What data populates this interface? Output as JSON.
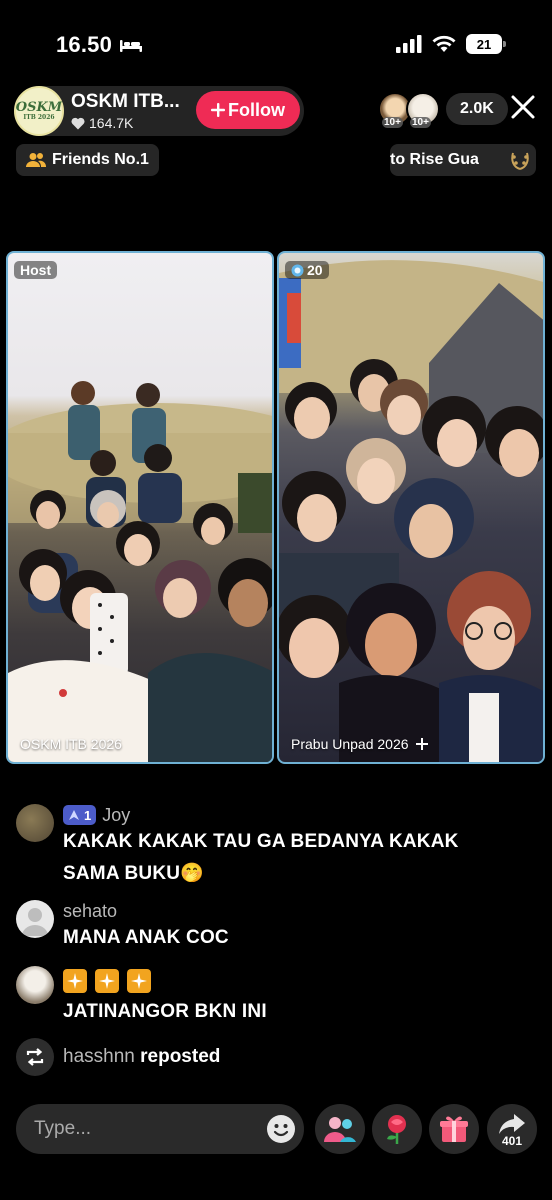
{
  "status_bar": {
    "time": "16.50",
    "battery": "21"
  },
  "host": {
    "avatar_text_big": "OSKM",
    "avatar_text_small": "ITB 2026",
    "name": "OSKM ITB...",
    "likes": "164.7K",
    "follow_label": "Follow"
  },
  "viewers": {
    "badge_1": "10+",
    "badge_2": "10+",
    "count": "2.0K"
  },
  "chips": {
    "friends": "Friends No.1",
    "rank_text": "to Rise   Gua"
  },
  "panels": {
    "left": {
      "tag": "Host",
      "label": "OSKM ITB 2026"
    },
    "right": {
      "tag": "20",
      "label": "Prabu Unpad 2026"
    }
  },
  "comments": [
    {
      "level": "1",
      "user": "Joy",
      "text": "KAKAK KAKAK TAU GA BEDANYA KAKAK SAMA BUKU🤭"
    },
    {
      "user": "sehato",
      "text": "MANA ANAK COC"
    },
    {
      "user": "",
      "text": "JATINANGOR BKN INI"
    }
  ],
  "repost": {
    "user": "hasshnn",
    "action": "reposted"
  },
  "bottom_bar": {
    "placeholder": "Type...",
    "share_count": "401"
  },
  "colors": {
    "follow": "#ef2b55",
    "panel_border": "#6fb1d4",
    "level_badge": "#4c5cc9"
  }
}
